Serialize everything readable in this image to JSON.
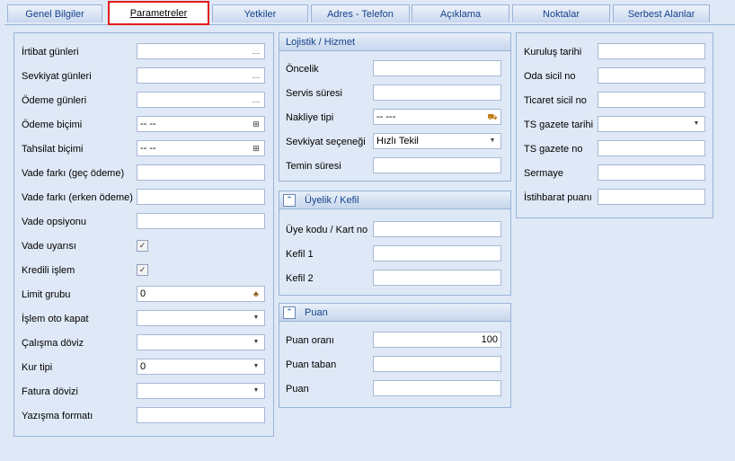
{
  "tabs": [
    {
      "label": "Genel Bilgiler"
    },
    {
      "label": "Parametreler"
    },
    {
      "label": "Yetkiler"
    },
    {
      "label": "Adres - Telefon"
    },
    {
      "label": "Açıklama"
    },
    {
      "label": "Noktalar"
    },
    {
      "label": "Serbest Alanlar"
    }
  ],
  "left": {
    "irtibat": {
      "label": "İrtibat günleri",
      "value": ""
    },
    "sevkiyat_gunleri": {
      "label": "Sevkiyat günleri",
      "value": ""
    },
    "odeme_gunleri": {
      "label": "Ödeme günleri",
      "value": ""
    },
    "odeme_bicimi": {
      "label": "Ödeme biçimi",
      "value": "-- --"
    },
    "tahsilat_bicimi": {
      "label": "Tahsilat biçimi",
      "value": "-- --"
    },
    "vade_farki_gec": {
      "label": "Vade farkı (geç ödeme)",
      "value": ""
    },
    "vade_farki_erken": {
      "label": "Vade farkı (erken ödeme)",
      "value": ""
    },
    "vade_opsiyonu": {
      "label": "Vade opsiyonu",
      "value": ""
    },
    "vade_uyarisi": {
      "label": "Vade uyarısı",
      "checked": true
    },
    "kredili_islem": {
      "label": "Kredili işlem",
      "checked": true
    },
    "limit_grubu": {
      "label": "Limit grubu",
      "value": "0"
    },
    "islem_oto_kapat": {
      "label": "İşlem oto kapat",
      "value": ""
    },
    "calisma_doviz": {
      "label": "Çalışma döviz",
      "value": ""
    },
    "kur_tipi": {
      "label": "Kur tipi",
      "value": "0"
    },
    "fatura_dovizi": {
      "label": "Fatura dövizi",
      "value": ""
    },
    "yazisma_formati": {
      "label": "Yazışma formatı",
      "value": ""
    }
  },
  "lojistik": {
    "title": "Lojistik / Hizmet",
    "oncelik": {
      "label": "Öncelik",
      "value": ""
    },
    "servis_suresi": {
      "label": "Servis süresi",
      "value": ""
    },
    "nakliye_tipi": {
      "label": "Nakliye tipi",
      "value": "-- ---"
    },
    "sevkiyat_secenegi": {
      "label": "Sevkiyat seçeneği",
      "value": "Hızlı Tekil"
    },
    "temin_suresi": {
      "label": "Temin süresi",
      "value": ""
    }
  },
  "uyelik": {
    "title": "Üyelik / Kefil",
    "uye_kodu": {
      "label": "Üye kodu / Kart no",
      "value": ""
    },
    "kefil1": {
      "label": "Kefil 1",
      "value": ""
    },
    "kefil2": {
      "label": "Kefil 2",
      "value": ""
    }
  },
  "puan": {
    "title": "Puan",
    "puan_orani": {
      "label": "Puan oranı",
      "value": "100"
    },
    "puan_taban": {
      "label": "Puan taban",
      "value": ""
    },
    "puan": {
      "label": "Puan",
      "value": ""
    }
  },
  "right": {
    "kurulus_tarihi": {
      "label": "Kuruluş tarihi",
      "value": ""
    },
    "oda_sicil": {
      "label": "Oda sicil no",
      "value": ""
    },
    "ticaret_sicil": {
      "label": "Ticaret sicil no",
      "value": ""
    },
    "ts_gazete_tarihi": {
      "label": "TS gazete tarihi",
      "value": ""
    },
    "ts_gazete_no": {
      "label": "TS gazete no",
      "value": ""
    },
    "sermaye": {
      "label": "Sermaye",
      "value": ""
    },
    "istihbarat_puani": {
      "label": "İstihbarat puanı",
      "value": ""
    }
  },
  "icons": {
    "ellipsis": "ellipsis-icon",
    "lookup": "lookup-tree-icon",
    "dropdown": "dropdown-arrow-icon",
    "truck": "truck-icon",
    "group": "group-icon",
    "collapse": "collapse-icon",
    "check": "checkmark-icon"
  },
  "colors": {
    "accent_border": "#e31a1a",
    "panel_bg": "#dfe8f6",
    "header_text": "#15428b"
  }
}
